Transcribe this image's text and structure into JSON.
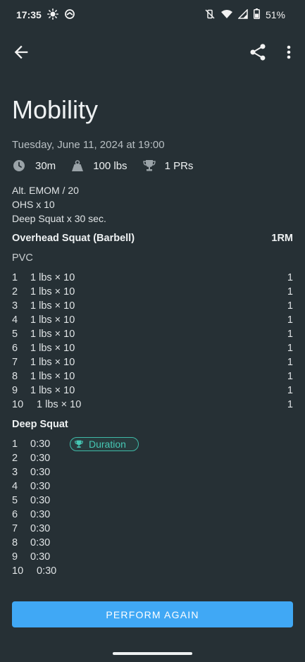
{
  "status_bar": {
    "time": "17:35",
    "battery": "51%",
    "icons": [
      "brightness-icon",
      "sync-icon",
      "vibrate-off-icon",
      "wifi-icon",
      "signal-icon",
      "battery-icon"
    ]
  },
  "toolbar": {
    "icons": [
      "arrow-back-icon",
      "share-icon",
      "more-vert-icon"
    ]
  },
  "workout": {
    "title": "Mobility",
    "date": "Tuesday, June 11, 2024 at 19:00",
    "duration": "30m",
    "volume": "100 lbs",
    "prs": "1 PRs",
    "description": [
      "Alt. EMOM / 20",
      "OHS x 10",
      "Deep Squat x 30 sec."
    ]
  },
  "exercises": [
    {
      "name": "Overhead Squat (Barbell)",
      "column_label": "1RM",
      "note": "PVC",
      "sets": [
        {
          "num": "1",
          "value": "1 lbs × 10",
          "rm": "1"
        },
        {
          "num": "2",
          "value": "1 lbs × 10",
          "rm": "1"
        },
        {
          "num": "3",
          "value": "1 lbs × 10",
          "rm": "1"
        },
        {
          "num": "4",
          "value": "1 lbs × 10",
          "rm": "1"
        },
        {
          "num": "5",
          "value": "1 lbs × 10",
          "rm": "1"
        },
        {
          "num": "6",
          "value": "1 lbs × 10",
          "rm": "1"
        },
        {
          "num": "7",
          "value": "1 lbs × 10",
          "rm": "1"
        },
        {
          "num": "8",
          "value": "1 lbs × 10",
          "rm": "1"
        },
        {
          "num": "9",
          "value": "1 lbs × 10",
          "rm": "1"
        },
        {
          "num": "10",
          "value": "1 lbs × 10",
          "rm": "1"
        }
      ]
    },
    {
      "name": "Deep Squat",
      "sets": [
        {
          "num": "1",
          "value": "0:30",
          "badge": "Duration"
        },
        {
          "num": "2",
          "value": "0:30"
        },
        {
          "num": "3",
          "value": "0:30"
        },
        {
          "num": "4",
          "value": "0:30"
        },
        {
          "num": "5",
          "value": "0:30"
        },
        {
          "num": "6",
          "value": "0:30"
        },
        {
          "num": "7",
          "value": "0:30"
        },
        {
          "num": "8",
          "value": "0:30"
        },
        {
          "num": "9",
          "value": "0:30"
        },
        {
          "num": "10",
          "value": "0:30"
        }
      ]
    }
  ],
  "actions": {
    "perform_again": "PERFORM AGAIN"
  },
  "colors": {
    "background": "#263035",
    "accent": "#40a8f5",
    "pr_badge": "#46c7b4"
  }
}
